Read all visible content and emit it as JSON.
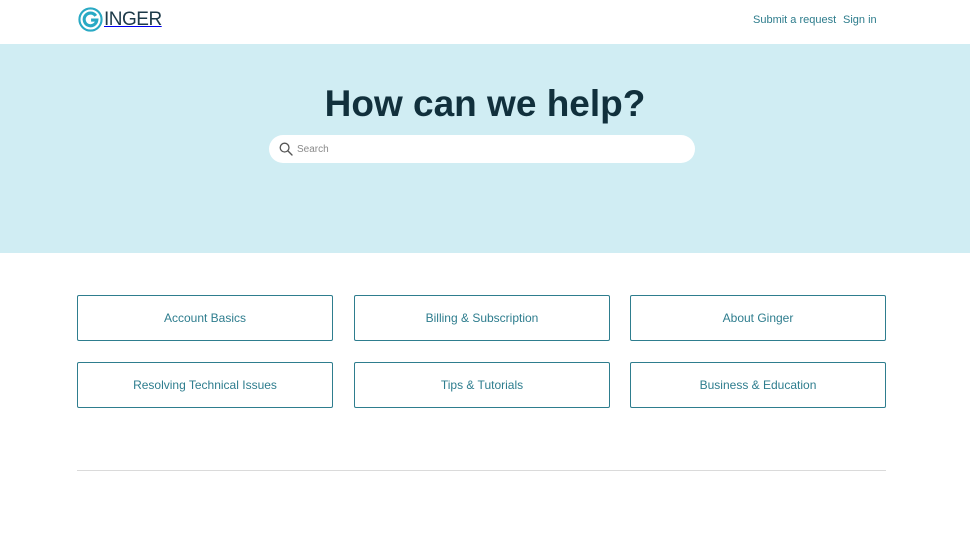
{
  "header": {
    "logo_text": "INGER",
    "brand_color": "#1d3a49",
    "logo_mark_color": "#29a9c4",
    "nav": {
      "submit_request": "Submit a request",
      "sign_in": "Sign in"
    }
  },
  "hero": {
    "title": "How can we help?",
    "background": "#d0edf3",
    "search": {
      "placeholder": "Search",
      "value": "",
      "icon": "search-icon"
    }
  },
  "categories": [
    {
      "label": "Account Basics"
    },
    {
      "label": "Billing & Subscription"
    },
    {
      "label": "About Ginger"
    },
    {
      "label": "Resolving Technical Issues"
    },
    {
      "label": "Tips & Tutorials"
    },
    {
      "label": "Business & Education"
    }
  ],
  "colors": {
    "accent": "#2e7d8e",
    "title": "#11303c"
  }
}
